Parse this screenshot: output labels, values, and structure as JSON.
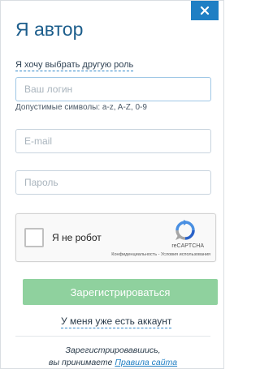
{
  "dialog": {
    "title": "Я автор",
    "close_label": "×",
    "role_link": "Я хочу выбрать другую роль"
  },
  "form": {
    "login_placeholder": "Ваш логин",
    "login_hint": "Допустимые символы: a-z, A-Z, 0-9",
    "email_placeholder": "E-mail",
    "password_placeholder": "Пароль"
  },
  "captcha": {
    "label": "Я не робот",
    "brand": "reCAPTCHA",
    "privacy": "Конфиденциальность",
    "separator": " - ",
    "terms": "Условия использования"
  },
  "actions": {
    "submit_label": "Зарегистрироваться",
    "has_account_link": "У меня уже есть аккаунт"
  },
  "footer": {
    "line1": "Зарегистрировавшись,",
    "line2_prefix": "вы принимаете ",
    "rules_link": "Правила сайта"
  },
  "colors": {
    "accent": "#1f7fc4",
    "title": "#1d5e8c",
    "submit_disabled": "#8fd19e"
  }
}
